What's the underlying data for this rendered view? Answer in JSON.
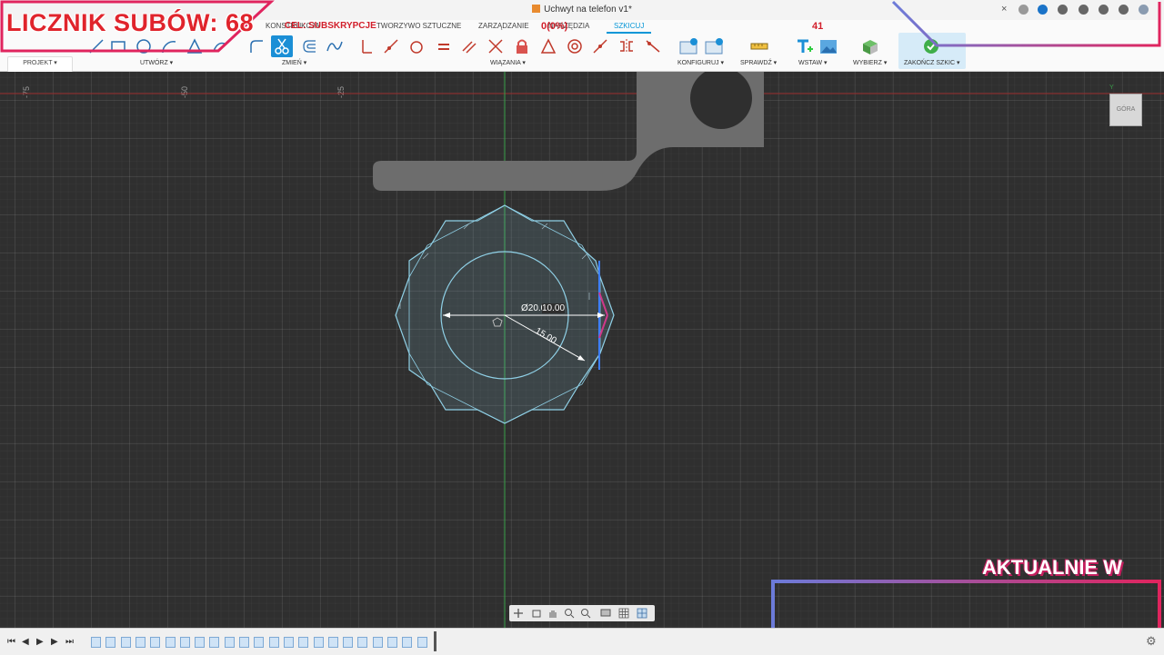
{
  "window": {
    "document_title": "Uchwyt na telefon v1*",
    "close_tab_glyph": "×"
  },
  "toolbar": {
    "tabs": [
      {
        "label": "KONSTRUKCJA"
      },
      {
        "label": "TWORZYWO SZTUCZNE"
      },
      {
        "label": "ZARZĄDZANIE"
      },
      {
        "label": "NARZĘDZIA"
      },
      {
        "label": "SZKICUJ",
        "active": true
      }
    ],
    "project_button": "PROJEKT ▾",
    "groups": {
      "create": "UTWÓRZ ▾",
      "modify": "ZMIEŃ ▾",
      "constraints": "WIĄZANIA ▾",
      "configure": "KONFIGURUJ ▾",
      "inspect": "SPRAWDŹ ▾",
      "insert": "WSTAW ▾",
      "select": "WYBIERZ ▾",
      "finish_sketch": "ZAKOŃCZ SZKIC ▾"
    },
    "accent_color": "#0696d7"
  },
  "canvas": {
    "ruler_labels": [
      "-75",
      "-50",
      "-25"
    ],
    "dimensions": {
      "diameter": "Ø20.00",
      "linear": "10.00",
      "radius": "15.00"
    },
    "viewcube_label": "GÓRA",
    "axis_y_label": "Y",
    "sketch_color": "#8fd0e6"
  },
  "overlay": {
    "sub_counter": "LICZNIK SUBÓW: 68",
    "goal_label": "CEL: SUBSKRYPCJE",
    "goal_percent": "0(0%)",
    "goal_count": "41",
    "now_label": "AKTUALNIE W",
    "frame_colors": [
      "#e0245e",
      "#6c7bd9"
    ]
  },
  "timeline": {
    "controls": [
      "⏮",
      "◀",
      "▶",
      "▶",
      "⏭"
    ],
    "item_count": 23
  }
}
